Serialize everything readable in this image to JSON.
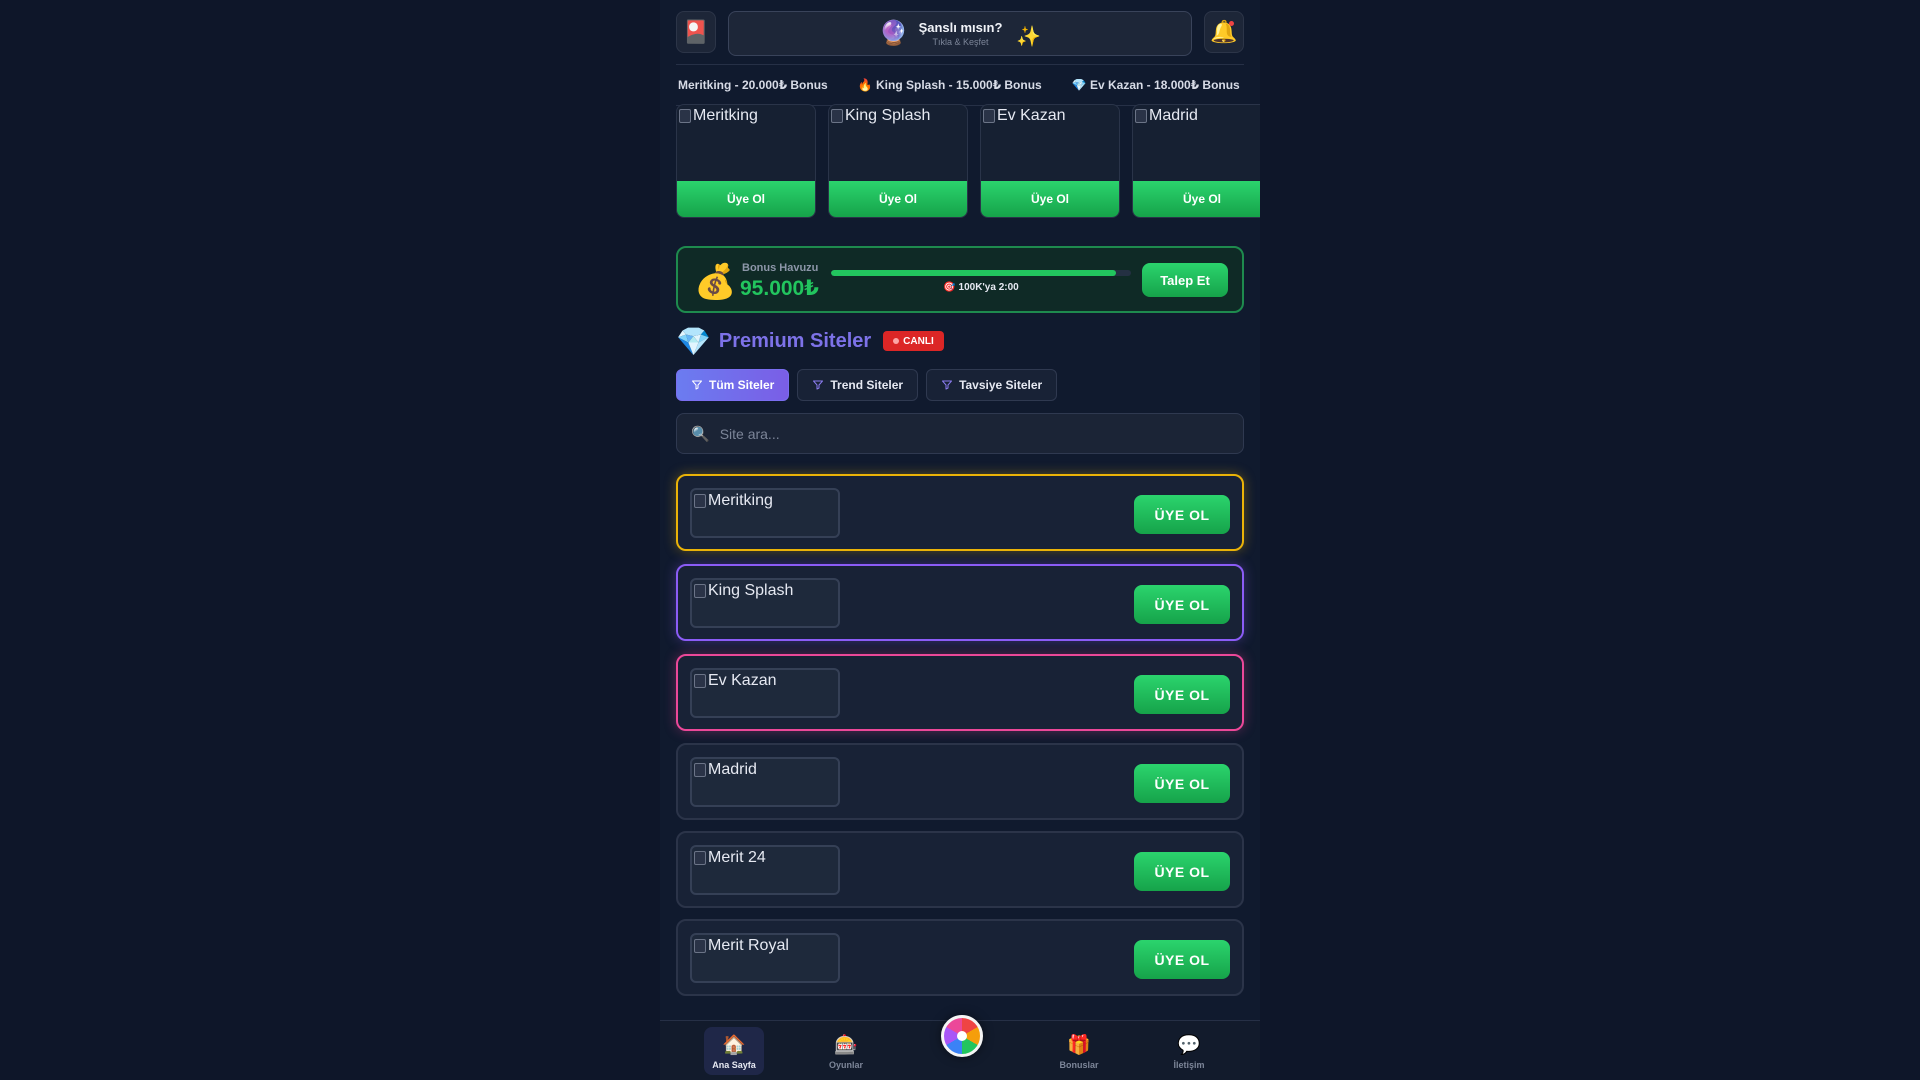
{
  "header": {
    "menu_icon": "card-icon",
    "menu_glyph": "🎴",
    "lucky_title": "Şanslı mısın?",
    "lucky_subtitle": "Tıkla & Keşfet",
    "orb_glyph": "🔮",
    "spark_glyph": "✨",
    "bell_glyph": "🔔"
  },
  "ticker": {
    "items": [
      "Meritking - 20.000₺ Bonus",
      "🔥 King Splash - 15.000₺ Bonus",
      "💎 Ev Kazan - 18.000₺ Bonus"
    ]
  },
  "carousel": {
    "cards": [
      {
        "name": "Meritking",
        "cta": "Üye Ol"
      },
      {
        "name": "King Splash",
        "cta": "Üye Ol"
      },
      {
        "name": "Ev Kazan",
        "cta": "Üye Ol"
      },
      {
        "name": "Madrid",
        "cta": "Üye Ol"
      }
    ]
  },
  "bonus_pool": {
    "label": "Bonus Havuzu",
    "amount": "95.000₺",
    "progress_fraction": 0.95,
    "countdown": "🎯 100K'ya 2:00",
    "claim_label": "Talep Et",
    "bag_glyph": "💰"
  },
  "premium": {
    "title": "Premium Siteler",
    "gem_glyph": "💎",
    "live_badge": "CANLI"
  },
  "filters": {
    "items": [
      {
        "label": "Tüm Siteler",
        "active": true
      },
      {
        "label": "Trend Siteler",
        "active": false
      },
      {
        "label": "Tavsiye Siteler",
        "active": false
      }
    ]
  },
  "search": {
    "placeholder": "Site ara...",
    "icon_glyph": "🔍"
  },
  "sites": {
    "items": [
      {
        "name": "Meritking",
        "cta": "ÜYE OL",
        "highlight": "gold"
      },
      {
        "name": "King Splash",
        "cta": "ÜYE OL",
        "highlight": "purple"
      },
      {
        "name": "Ev Kazan",
        "cta": "ÜYE OL",
        "highlight": "pink"
      },
      {
        "name": "Madrid",
        "cta": "ÜYE OL",
        "highlight": "none"
      },
      {
        "name": "Merit 24",
        "cta": "ÜYE OL",
        "highlight": "none"
      },
      {
        "name": "Merit Royal",
        "cta": "ÜYE OL",
        "highlight": "none"
      }
    ]
  },
  "bottom_nav": {
    "items": [
      {
        "label": "Ana Sayfa",
        "glyph": "🏠",
        "active": true
      },
      {
        "label": "Oyunlar",
        "glyph": "🎰",
        "active": false
      },
      {
        "label": "Bonuslar",
        "glyph": "🎁",
        "active": false
      },
      {
        "label": "İletişim",
        "glyph": "💬",
        "active": false
      }
    ]
  },
  "colors": {
    "accent_green": "#22c55e",
    "accent_purple": "#7a5ee6",
    "live_red": "#dc2626",
    "gold": "#eab308",
    "pink": "#ec4899"
  }
}
